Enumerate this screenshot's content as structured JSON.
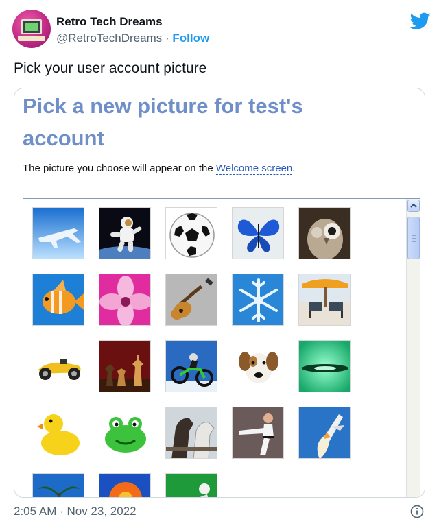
{
  "tweet": {
    "author_name": "Retro Tech Dreams",
    "handle": "@RetroTechDreams",
    "separator": " · ",
    "follow_label": "Follow",
    "text": "Pick your user account picture",
    "timestamp": "2:05 AM · Nov 23, 2022"
  },
  "dialog": {
    "title_line1": "Pick a new picture for test's",
    "title_line2": "account",
    "desc_prefix": "The picture you choose will appear on the ",
    "desc_link": "Welcome screen",
    "desc_suffix": "."
  },
  "pictures": [
    {
      "name": "airplane"
    },
    {
      "name": "astronaut"
    },
    {
      "name": "soccer-ball"
    },
    {
      "name": "butterfly"
    },
    {
      "name": "owl"
    },
    {
      "name": "fish"
    },
    {
      "name": "flower"
    },
    {
      "name": "guitar"
    },
    {
      "name": "snowflake"
    },
    {
      "name": "beach-chairs"
    },
    {
      "name": "race-car"
    },
    {
      "name": "chess"
    },
    {
      "name": "dirt-bike"
    },
    {
      "name": "dog"
    },
    {
      "name": "green-abstract"
    },
    {
      "name": "rubber-duck"
    },
    {
      "name": "frog"
    },
    {
      "name": "horses"
    },
    {
      "name": "karate"
    },
    {
      "name": "space-shuttle"
    },
    {
      "name": "palm-tree"
    },
    {
      "name": "orange-flower"
    },
    {
      "name": "green-picture"
    }
  ],
  "colors": {
    "twitter_blue": "#1d9bf0",
    "dialog_title": "#6f8fc8",
    "link_blue": "#2a5bb8"
  }
}
